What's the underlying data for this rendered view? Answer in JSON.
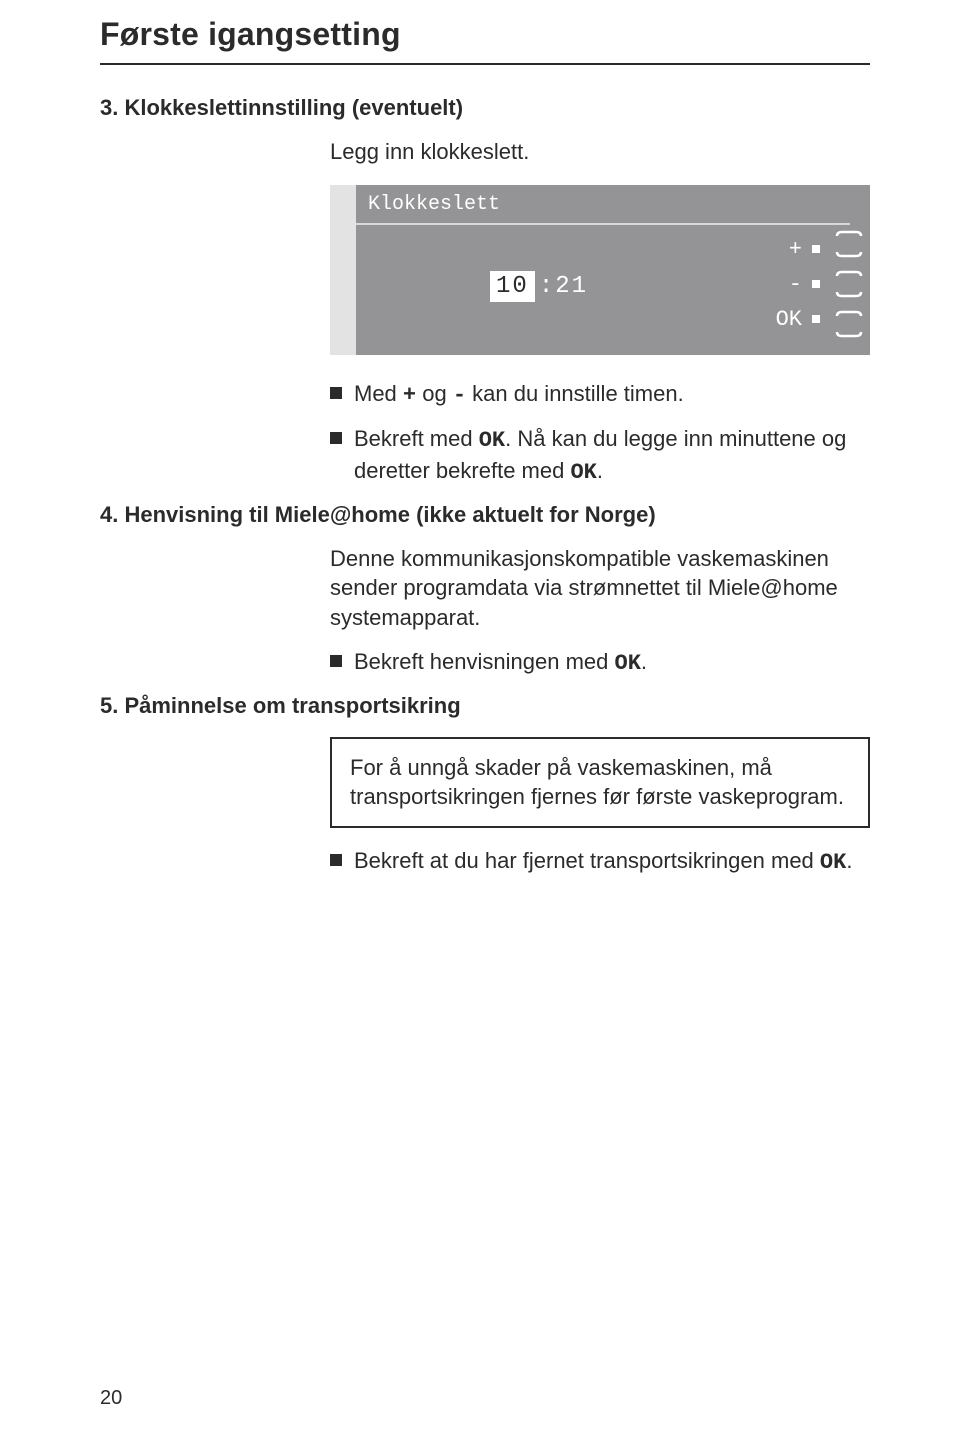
{
  "page": {
    "title": "Første igangsetting",
    "number": "20"
  },
  "section3": {
    "heading": "3. Klokkeslettinnstilling (eventuelt)",
    "intro": "Legg inn klokkeslett.",
    "panel": {
      "header": "Klokkeslett",
      "hour": "10",
      "minute": ":21",
      "plus": "+",
      "minus": "-",
      "ok": "OK"
    },
    "bullet1_pre": "Med ",
    "bullet1_plus": "+",
    "bullet1_mid": " og ",
    "bullet1_minus": "-",
    "bullet1_post": " kan du innstille timen.",
    "bullet2_pre": "Bekreft med ",
    "bullet2_ok": "OK",
    "bullet2_mid": ". Nå kan du legge inn minuttene og deretter bekrefte med ",
    "bullet2_ok2": "OK",
    "bullet2_post": "."
  },
  "section4": {
    "heading": "4. Henvisning til Miele@home (ikke aktuelt for Norge)",
    "para": "Denne kommunikasjonskompatible vaskemaskinen sender programdata via strømnettet til Miele@home systemapparat.",
    "bullet_pre": "Bekreft henvisningen med ",
    "bullet_ok": "OK",
    "bullet_post": "."
  },
  "section5": {
    "heading": "5. Påminnelse om transportsikring",
    "callout": "For å unngå skader på vaskemaskinen, må transportsikringen fjernes før første vaskeprogram.",
    "bullet_pre": "Bekreft at du har fjernet transportsikringen med ",
    "bullet_ok": "OK",
    "bullet_post": "."
  }
}
